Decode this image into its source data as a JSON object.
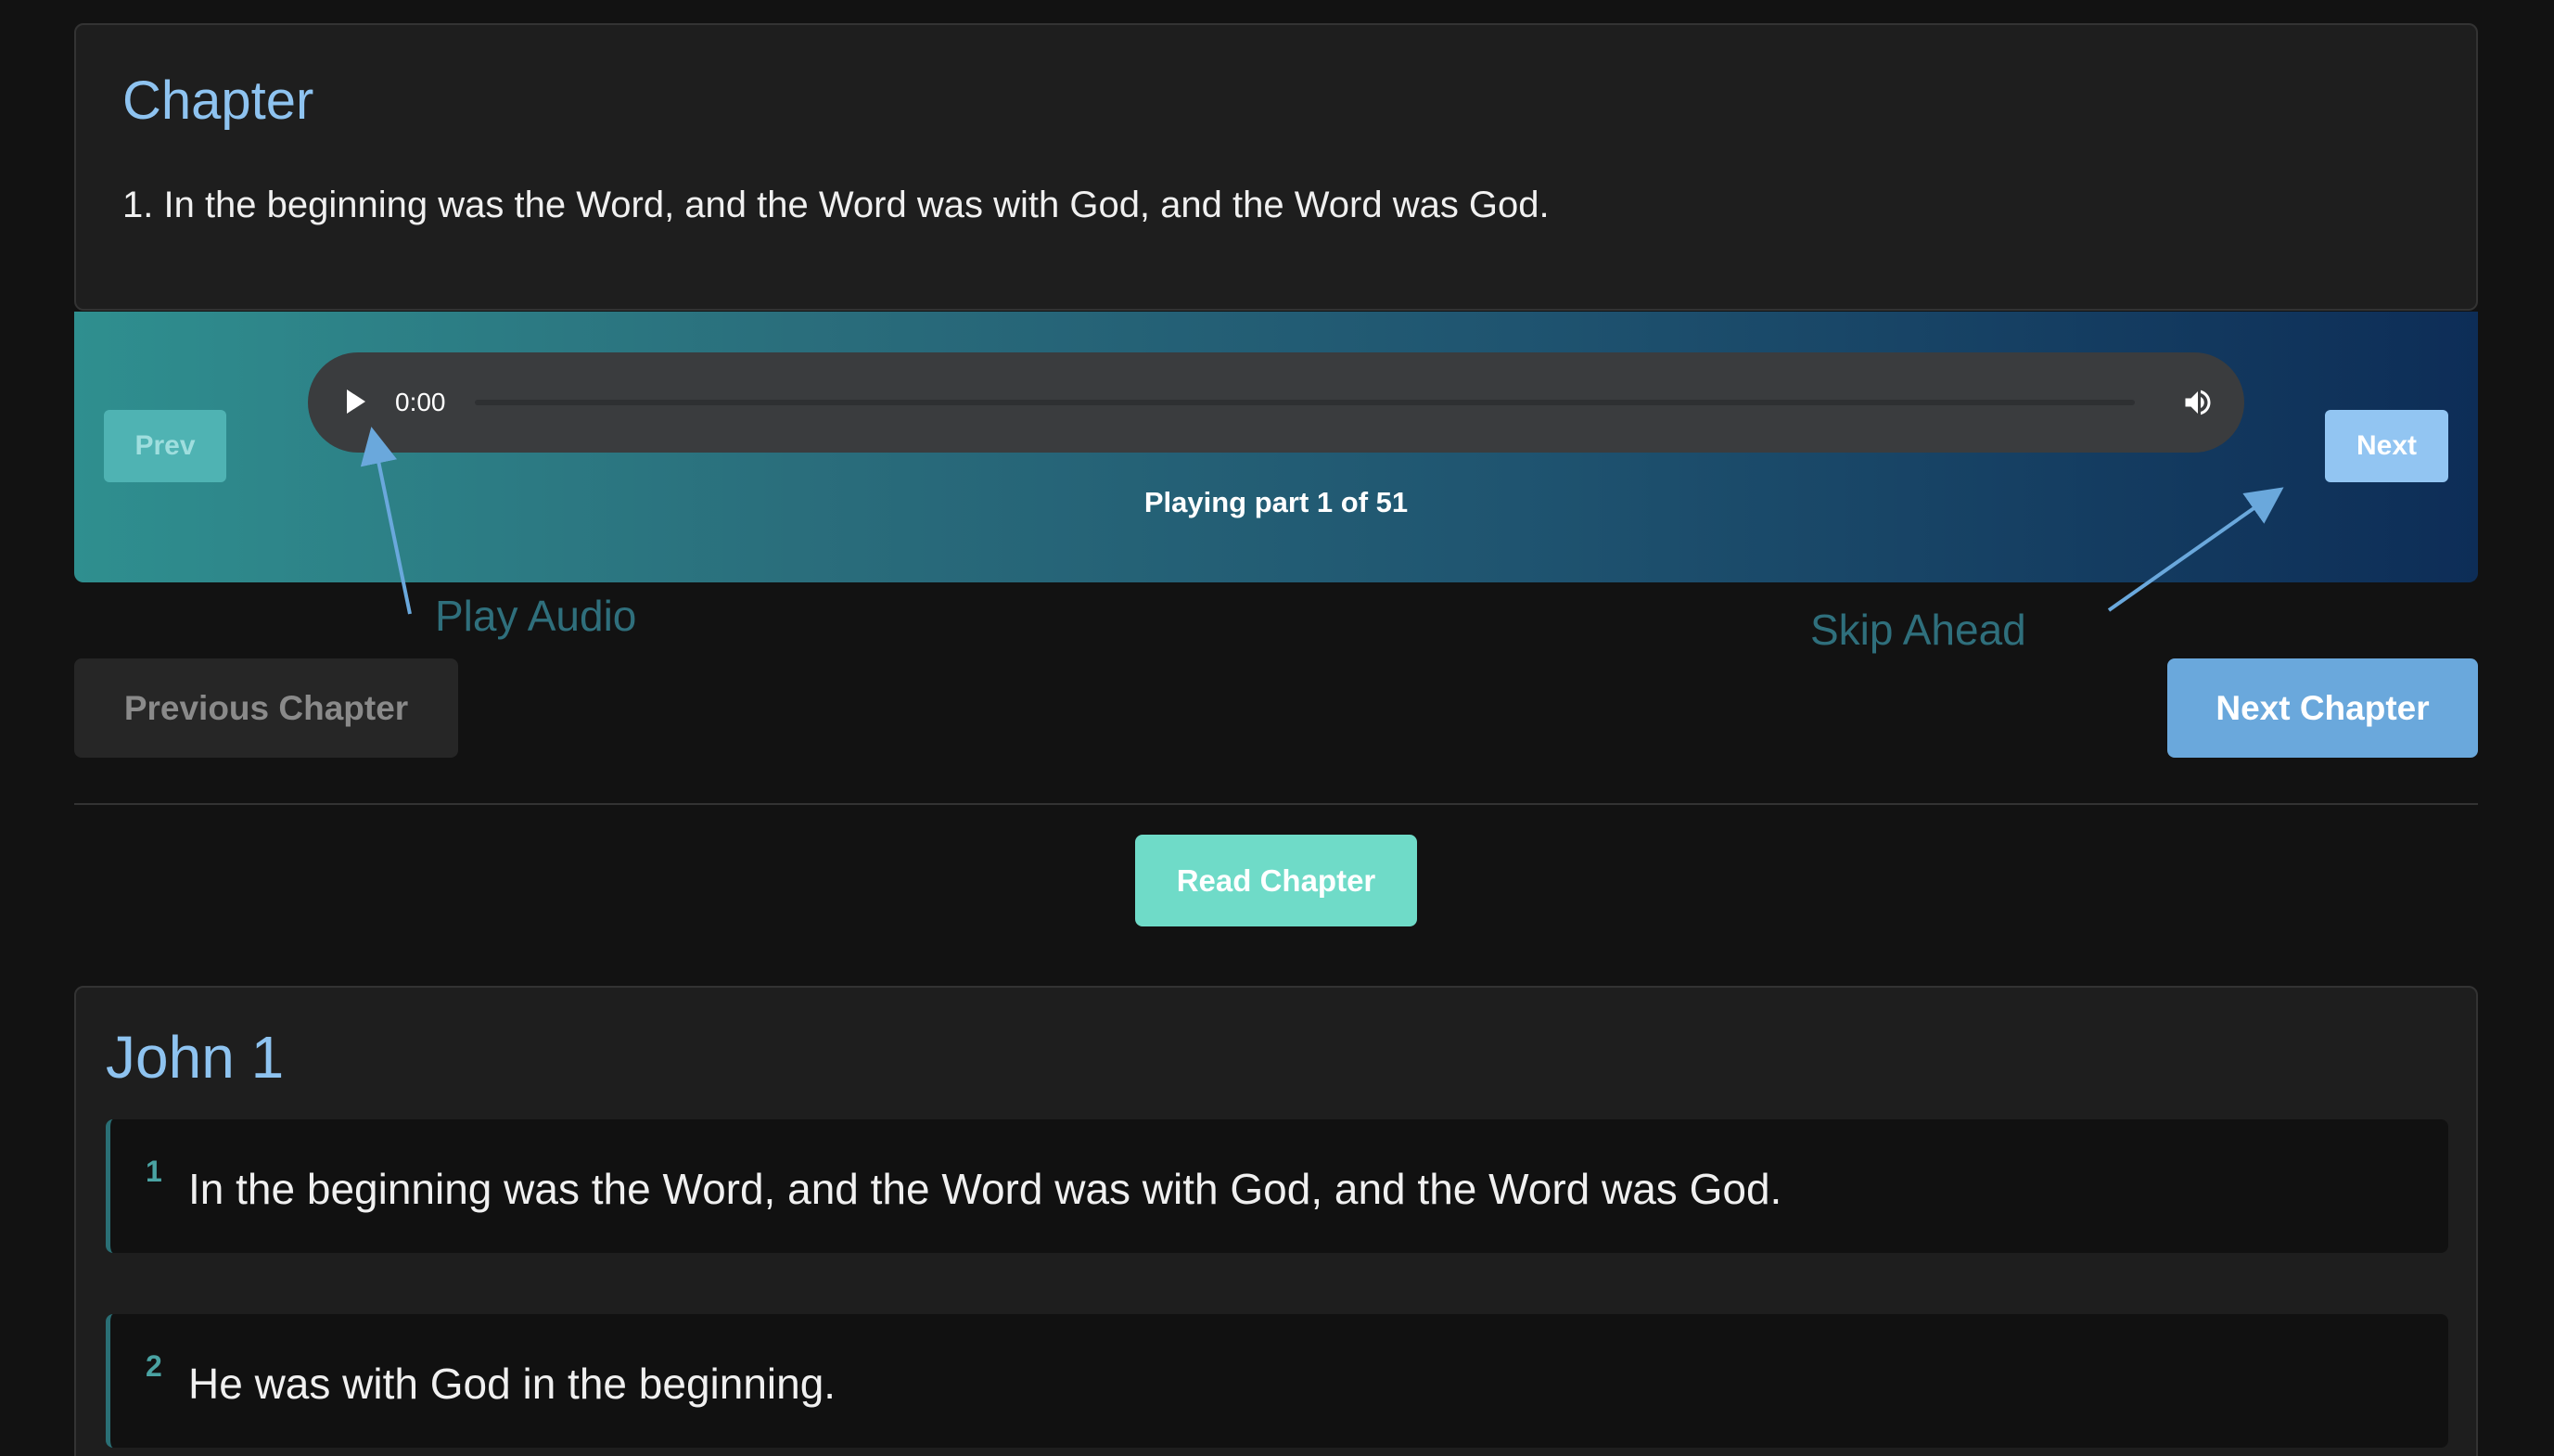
{
  "chapter": {
    "title": "Chapter",
    "current_verse_text": "1. In the beginning was the Word, and the Word was with God, and the Word was God."
  },
  "player": {
    "prev_label": "Prev",
    "next_label": "Next",
    "time": "0:00",
    "progress": 0,
    "status": "Playing part 1 of 51",
    "play_icon": "play-icon",
    "volume_icon": "volume-icon"
  },
  "annotations": {
    "play_audio": "Play Audio",
    "skip_ahead": "Skip Ahead",
    "color": "#2f6f7c"
  },
  "navigation": {
    "previous_chapter": "Previous Chapter",
    "next_chapter": "Next Chapter",
    "read_chapter": "Read Chapter"
  },
  "book": {
    "title": "John 1",
    "verses": [
      {
        "number": "1",
        "text": "In the beginning was the Word, and the Word was with God, and the Word was God."
      },
      {
        "number": "2",
        "text": "He was with God in the beginning."
      }
    ]
  },
  "colors": {
    "background": "#121212",
    "heading": "#8ec3f0",
    "prev_button": "#4fb3b3",
    "next_button": "#92c5f2",
    "next_chapter_button": "#6aa8dc",
    "read_chapter_button": "#6fdbc8"
  }
}
